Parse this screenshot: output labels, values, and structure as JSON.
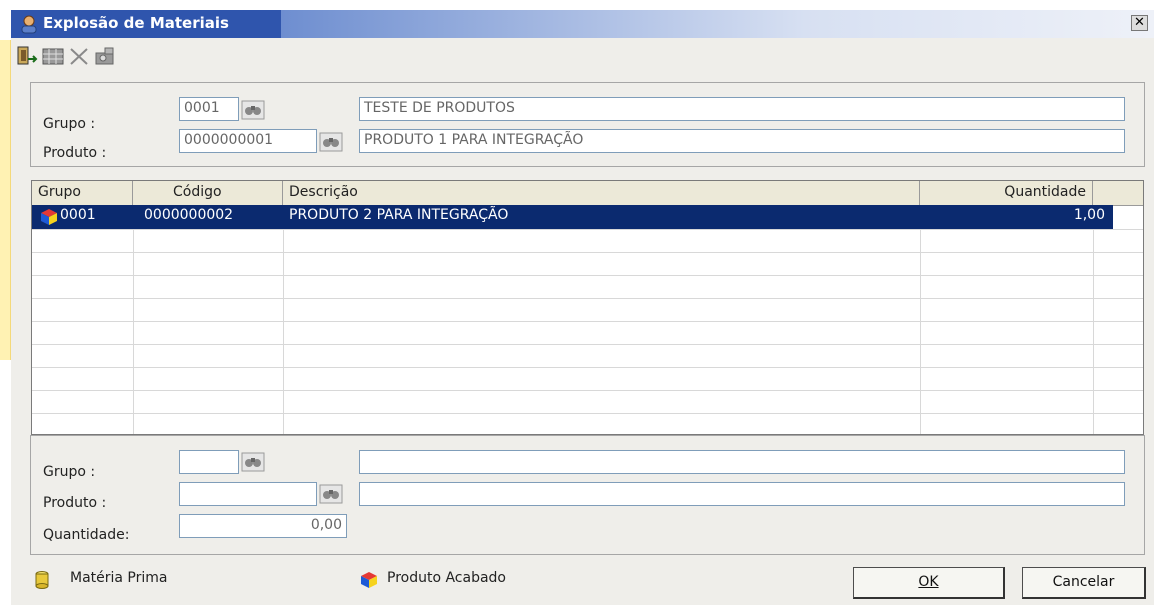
{
  "window": {
    "title": "Explosão de Materiais",
    "close_label": "✕"
  },
  "toolbar": {
    "icons": [
      "exit-icon",
      "grid-icon",
      "delete-icon",
      "camera-icon"
    ]
  },
  "header_form": {
    "grupo_label": "Grupo :",
    "grupo_code": "0001",
    "grupo_desc": "TESTE DE PRODUTOS",
    "produto_label": "Produto :",
    "produto_code": "0000000001",
    "produto_desc": "PRODUTO 1 PARA INTEGRAÇÃO"
  },
  "grid": {
    "columns": [
      "Grupo",
      "Código",
      "Descrição",
      "Quantidade"
    ],
    "rows": [
      {
        "grupo": "0001",
        "codigo": "0000000002",
        "descricao": "PRODUTO 2 PARA INTEGRAÇÃO",
        "quantidade": "1,00",
        "selected": true
      }
    ]
  },
  "entry_form": {
    "grupo_label": "Grupo :",
    "produto_label": "Produto :",
    "quantidade_label": "Quantidade:",
    "grupo_code": "",
    "grupo_desc": "",
    "produto_code": "",
    "produto_desc": "",
    "quantidade_value": "0,00"
  },
  "legend": {
    "materia_prima": "Matéria Prima",
    "produto_acabado": "Produto Acabado"
  },
  "buttons": {
    "ok": "OK",
    "cancelar": "Cancelar"
  },
  "colors": {
    "titlebar": "#2f55ad",
    "selection": "#0b2a6f",
    "left_band": "#fff2b3"
  }
}
